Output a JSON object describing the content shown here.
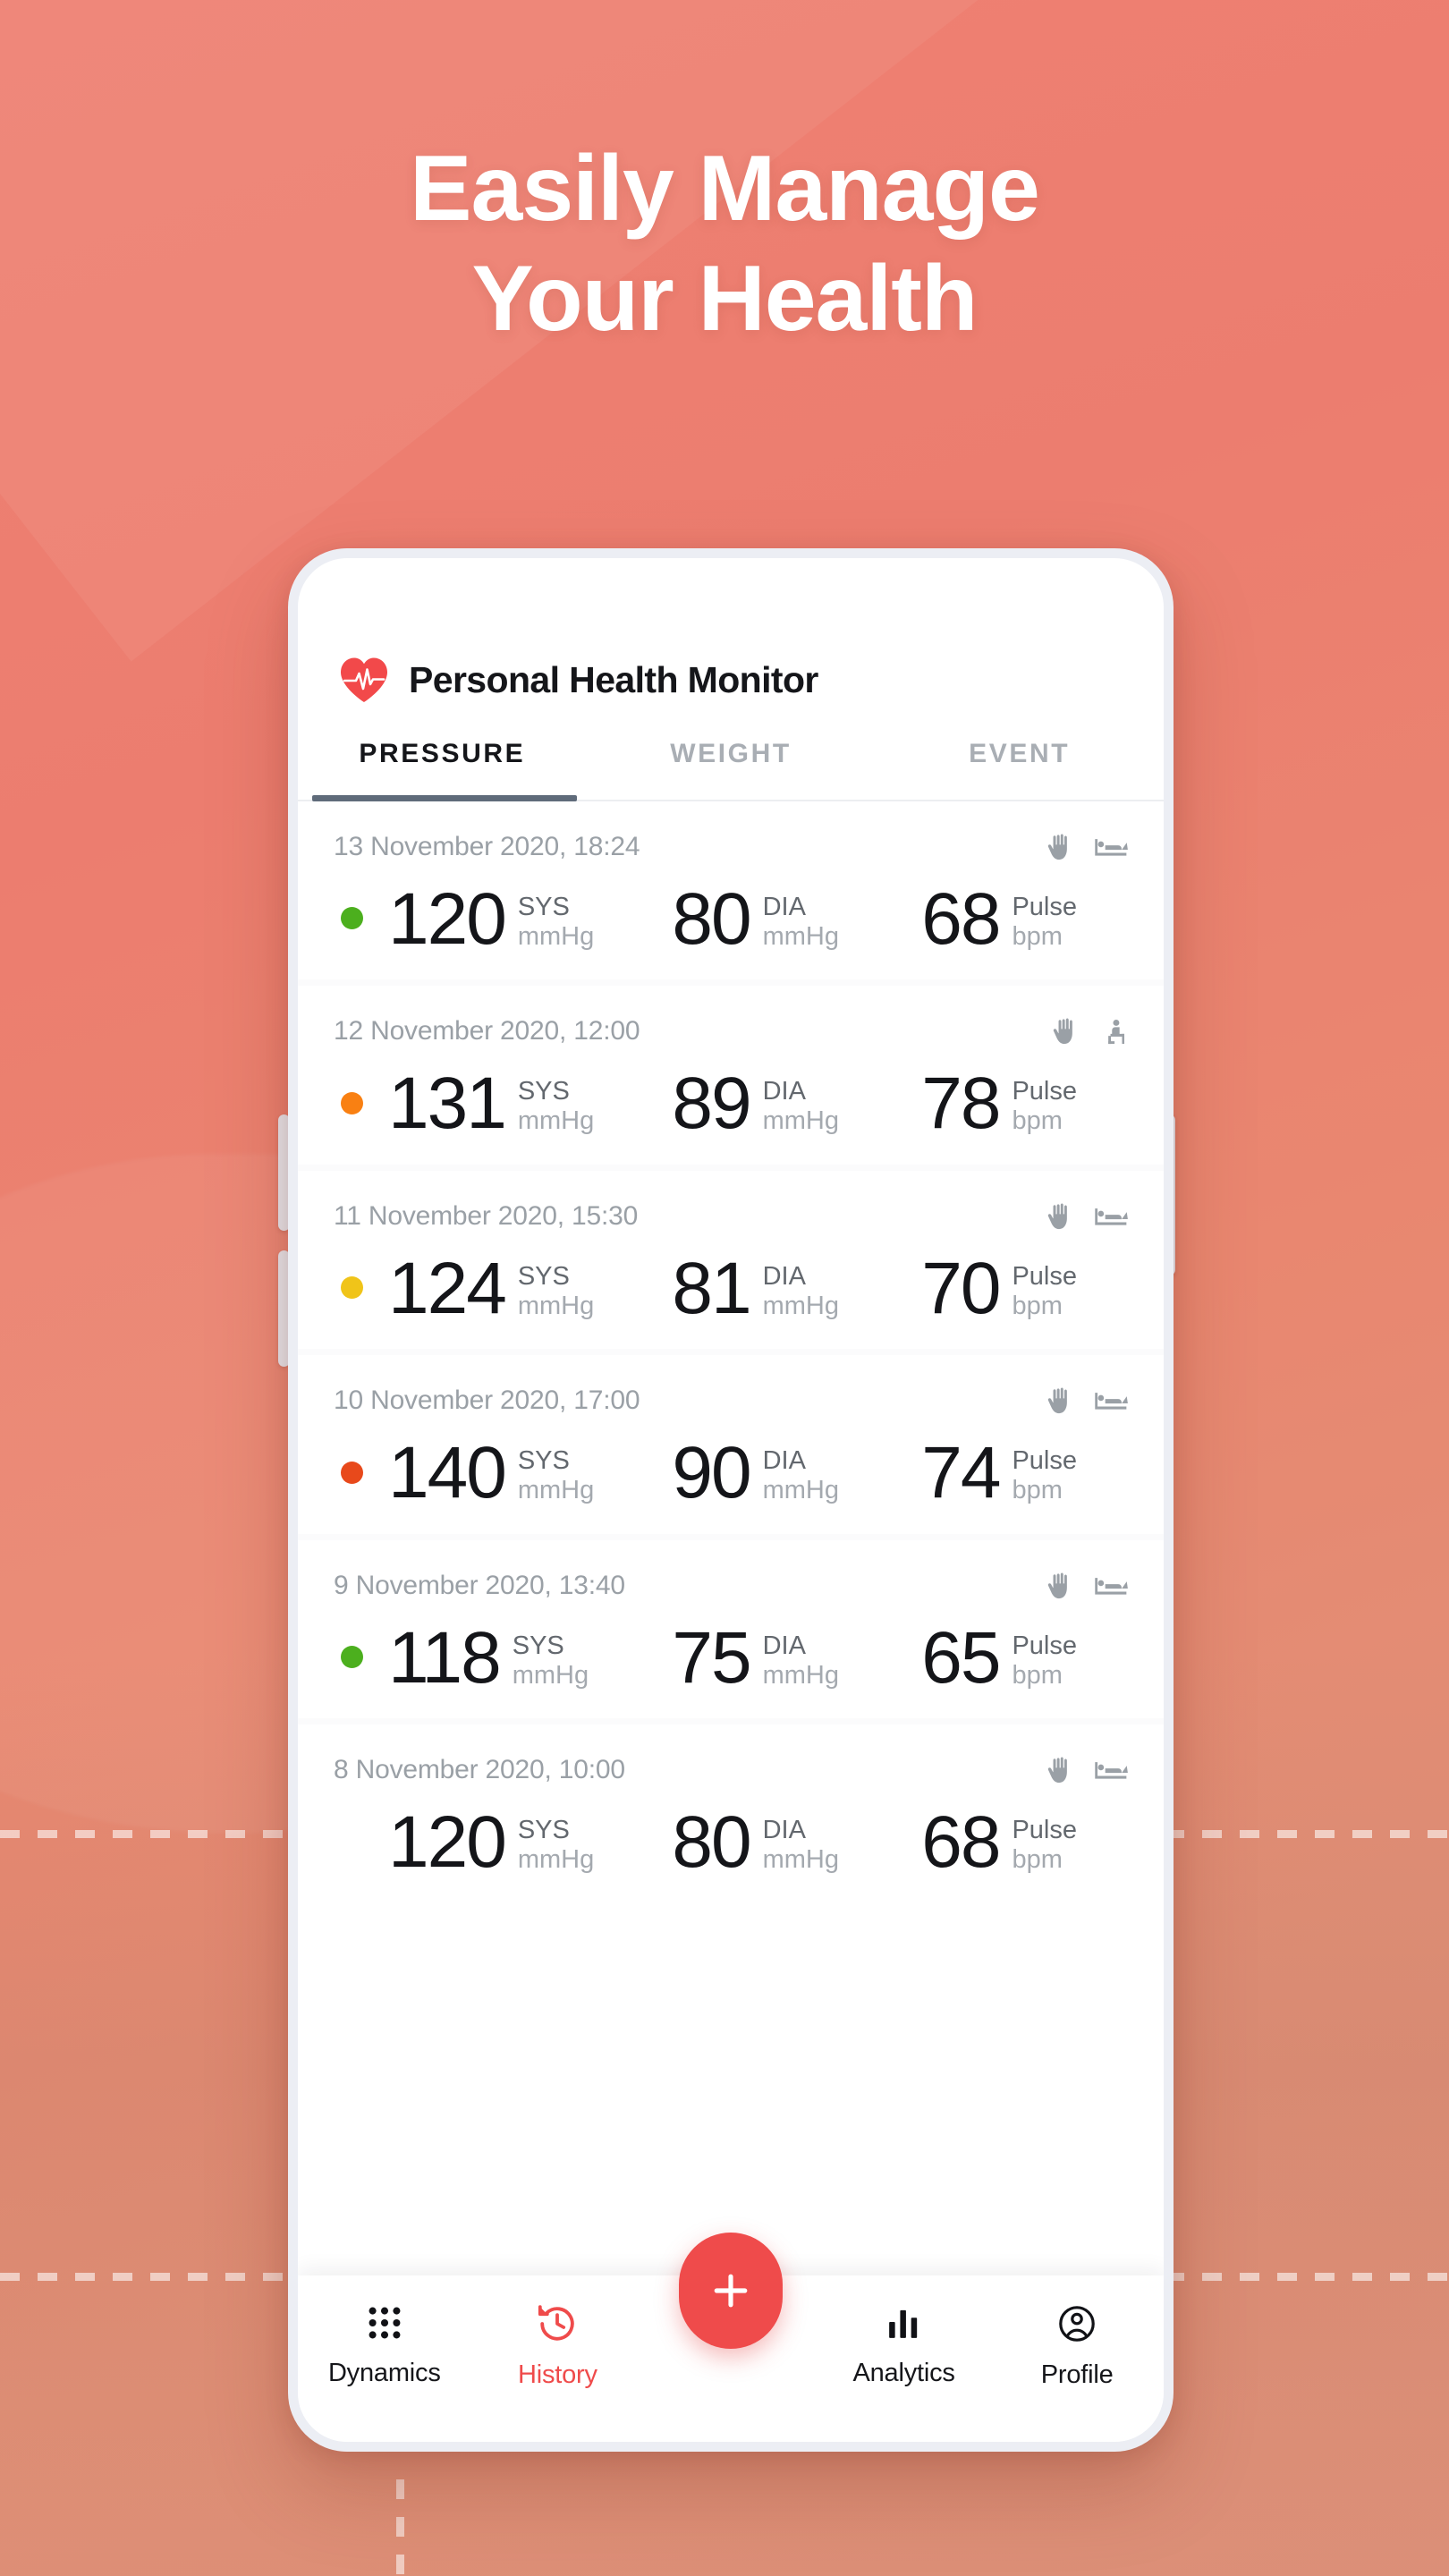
{
  "theme": {
    "background_start": "#ef8173",
    "background_end": "#dd9079",
    "accent": "#ef4b4b",
    "tab_underline": "#5f6b7a"
  },
  "headline": {
    "line1": "Easily Manage",
    "line2": "Your Health"
  },
  "app": {
    "title": "Personal Health Monitor",
    "logo_icon": "heart-pulse-icon"
  },
  "tabs": [
    {
      "label": "PRESSURE",
      "active": true
    },
    {
      "label": "WEIGHT",
      "active": false
    },
    {
      "label": "EVENT",
      "active": false
    }
  ],
  "units": {
    "sys_label": "SYS",
    "dia_label": "DIA",
    "pulse_label": "Pulse",
    "mmhg": "mmHg",
    "bpm": "bpm"
  },
  "readings": [
    {
      "date": "13 November 2020, 18:24",
      "sys": "120",
      "dia": "80",
      "pulse": "68",
      "status_color": "#4caf1e",
      "icons": [
        "hand-icon",
        "bed-lying-icon"
      ]
    },
    {
      "date": "12 November 2020, 12:00",
      "sys": "131",
      "dia": "89",
      "pulse": "78",
      "status_color": "#f98012",
      "icons": [
        "hand-icon",
        "person-sitting-icon"
      ]
    },
    {
      "date": "11 November 2020, 15:30",
      "sys": "124",
      "dia": "81",
      "pulse": "70",
      "status_color": "#f0c419",
      "icons": [
        "hand-icon",
        "bed-lying-icon"
      ]
    },
    {
      "date": "10 November 2020, 17:00",
      "sys": "140",
      "dia": "90",
      "pulse": "74",
      "status_color": "#e8491b",
      "icons": [
        "hand-icon",
        "bed-lying-icon"
      ]
    },
    {
      "date": "9 November 2020, 13:40",
      "sys": "118",
      "dia": "75",
      "pulse": "65",
      "status_color": "#4caf1e",
      "icons": [
        "hand-icon",
        "bed-lying-icon"
      ]
    },
    {
      "date": "8 November 2020, 10:00",
      "sys": "120",
      "dia": "80",
      "pulse": "68",
      "status_color": "",
      "icons": [
        "hand-icon",
        "bed-lying-icon"
      ]
    }
  ],
  "bottom_nav": {
    "items": [
      {
        "label": "Dynamics",
        "icon": "grid-dots-icon",
        "active": false
      },
      {
        "label": "History",
        "icon": "history-clock-icon",
        "active": true
      },
      {
        "label": "Analytics",
        "icon": "bar-chart-icon",
        "active": false
      },
      {
        "label": "Profile",
        "icon": "account-circle-icon",
        "active": false
      }
    ],
    "fab": {
      "icon": "plus-icon",
      "label": "+"
    }
  }
}
